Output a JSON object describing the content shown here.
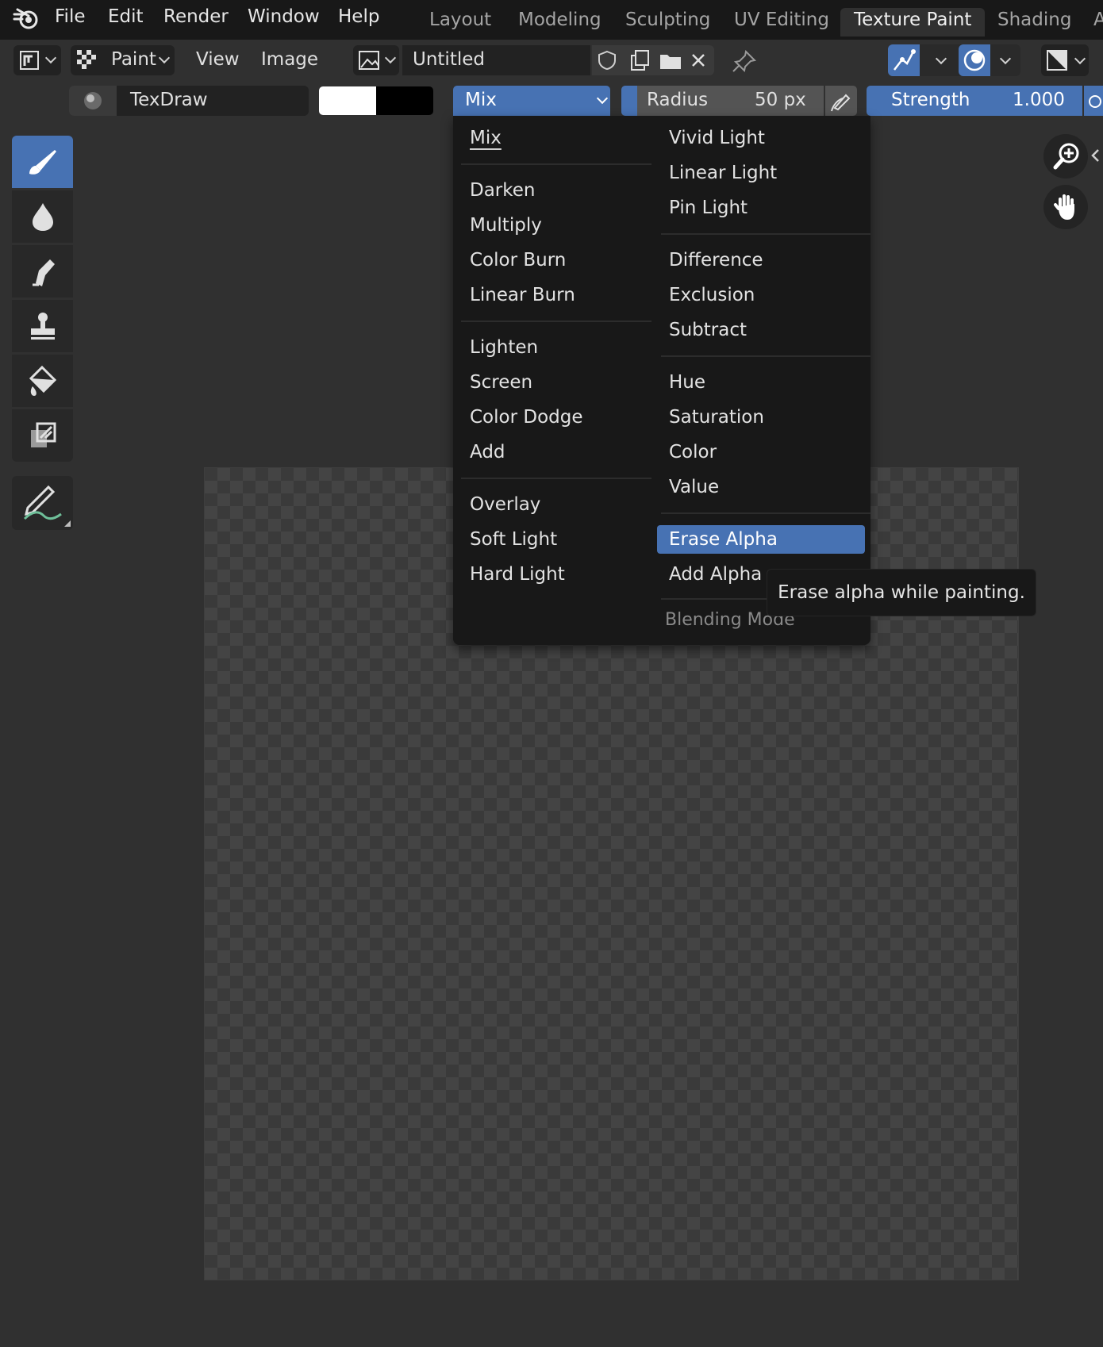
{
  "menubar": {
    "items": [
      "File",
      "Edit",
      "Render",
      "Window",
      "Help"
    ],
    "workspaces": [
      "Layout",
      "Modeling",
      "Sculpting",
      "UV Editing",
      "Texture Paint",
      "Shading",
      "A"
    ],
    "active_workspace": "Texture Paint"
  },
  "header": {
    "mode_label": "Paint",
    "view_label": "View",
    "image_label": "Image",
    "image_name": "Untitled"
  },
  "tool_settings": {
    "brush_name": "TexDraw",
    "primary_color": "#ffffff",
    "secondary_color": "#000000",
    "blend_mode": "Mix",
    "radius_label": "Radius",
    "radius_value": "50 px",
    "strength_label": "Strength",
    "strength_value": "1.000"
  },
  "toolbar": {
    "tools": [
      "brush-icon",
      "blur-icon",
      "smear-icon",
      "clone-icon",
      "fill-icon",
      "mask-icon",
      "annotate-icon"
    ],
    "active_tool": "brush-icon"
  },
  "blend_menu": {
    "left_groups": [
      [
        "Mix"
      ],
      [
        "Darken",
        "Multiply",
        "Color Burn",
        "Linear Burn"
      ],
      [
        "Lighten",
        "Screen",
        "Color Dodge",
        "Add"
      ],
      [
        "Overlay",
        "Soft Light",
        "Hard Light"
      ]
    ],
    "right_groups": [
      [
        "Vivid Light",
        "Linear Light",
        "Pin Light"
      ],
      [
        "Difference",
        "Exclusion",
        "Subtract"
      ],
      [
        "Hue",
        "Saturation",
        "Color",
        "Value"
      ],
      [
        "Erase Alpha",
        "Add Alpha"
      ]
    ],
    "highlighted": "Erase Alpha",
    "footer_title": "Blending Mode",
    "tooltip": "Erase alpha while painting."
  },
  "colors": {
    "accent": "#4772b3",
    "background": "#303030",
    "menu_bg": "#181818"
  }
}
